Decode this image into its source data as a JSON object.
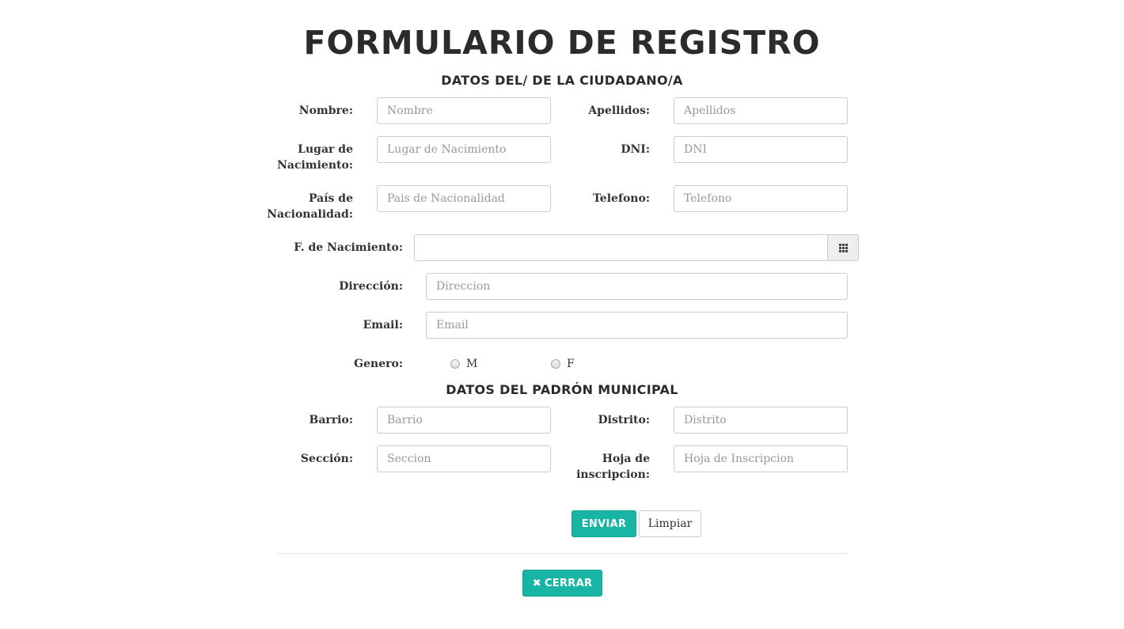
{
  "form": {
    "title": "FORMULARIO DE REGISTRO",
    "section_ciudadano": "DATOS DEL/ DE LA CIUDADANO/A",
    "section_padron": "DATOS DEL PADRÓN MUNICIPAL"
  },
  "ciudadano": {
    "nombre": {
      "label": "Nombre:",
      "placeholder": "Nombre",
      "value": ""
    },
    "apellidos": {
      "label": "Apellidos:",
      "placeholder": "Apellidos",
      "value": ""
    },
    "lugar_nacimiento": {
      "label_line1": "Lugar de",
      "label_line2": "Nacimiento:",
      "placeholder": "Lugar de Nacimiento",
      "value": ""
    },
    "dni": {
      "label": "DNI:",
      "placeholder": "DNI",
      "value": ""
    },
    "pais_nacionalidad": {
      "label_line1": "País de",
      "label_line2": "Nacionalidad:",
      "placeholder": "Pais de Nacionalidad",
      "value": ""
    },
    "telefono": {
      "label": "Telefono:",
      "placeholder": "Telefono",
      "value": ""
    },
    "fecha_nacimiento": {
      "label": "F. de Nacimiento:",
      "value": "",
      "icon": "calendar-grid-icon"
    },
    "direccion": {
      "label": "Dirección:",
      "placeholder": "Direccion",
      "value": ""
    },
    "email": {
      "label": "Email:",
      "placeholder": "Email",
      "value": ""
    },
    "genero": {
      "label": "Genero:",
      "options": [
        "M",
        "F"
      ],
      "selected": null
    }
  },
  "padron": {
    "barrio": {
      "label": "Barrio:",
      "placeholder": "Barrio",
      "value": ""
    },
    "distrito": {
      "label": "Distrito:",
      "placeholder": "Distrito",
      "value": ""
    },
    "seccion": {
      "label": "Sección:",
      "placeholder": "Seccion",
      "value": ""
    },
    "hoja_inscripcion": {
      "label_line1": "Hoja de",
      "label_line2": "inscripcion:",
      "placeholder": "Hoja de Inscripcion",
      "value": ""
    }
  },
  "actions": {
    "enviar": "ENVIAR",
    "limpiar": "Limpiar",
    "cerrar": "CERRAR",
    "cerrar_icon": "close-icon"
  },
  "colors": {
    "accent": "#18b5a5",
    "text": "#333333",
    "border": "#cccccc",
    "placeholder": "#999999"
  }
}
